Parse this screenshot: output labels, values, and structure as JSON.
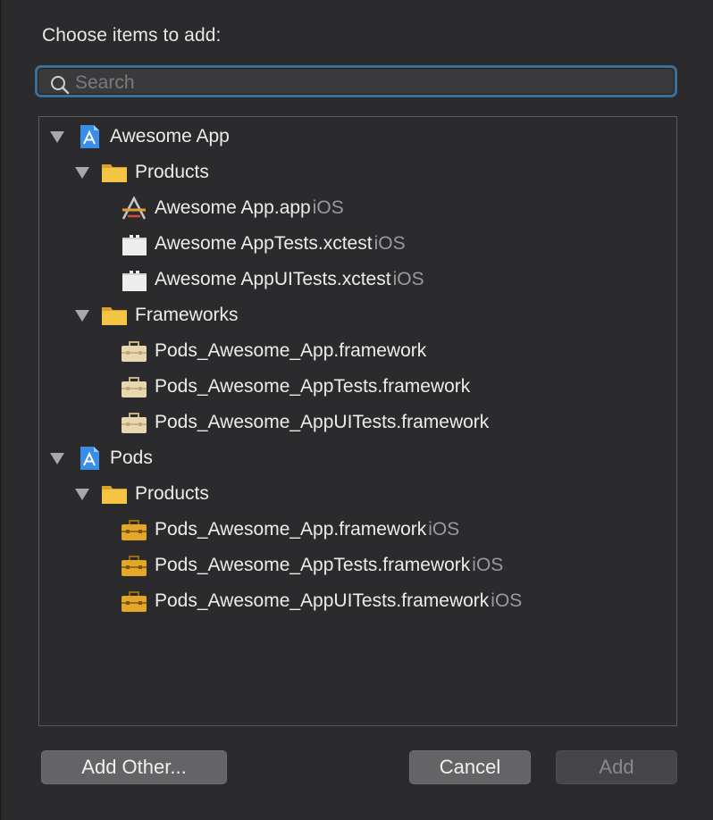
{
  "dialog": {
    "heading": "Choose items to add:"
  },
  "search": {
    "placeholder": "Search",
    "value": ""
  },
  "tree": {
    "awesome_app": {
      "label": "Awesome App",
      "products": {
        "label": "Products",
        "items": [
          {
            "name": "Awesome App.app",
            "platform": "iOS"
          },
          {
            "name": "Awesome AppTests.xctest",
            "platform": "iOS"
          },
          {
            "name": "Awesome AppUITests.xctest",
            "platform": "iOS"
          }
        ]
      },
      "frameworks": {
        "label": "Frameworks",
        "items": [
          {
            "name": "Pods_Awesome_App.framework"
          },
          {
            "name": "Pods_Awesome_AppTests.framework"
          },
          {
            "name": "Pods_Awesome_AppUITests.framework"
          }
        ]
      }
    },
    "pods": {
      "label": "Pods",
      "products": {
        "label": "Products",
        "items": [
          {
            "name": "Pods_Awesome_App.framework",
            "platform": "iOS"
          },
          {
            "name": "Pods_Awesome_AppTests.framework",
            "platform": "iOS"
          },
          {
            "name": "Pods_Awesome_AppUITests.framework",
            "platform": "iOS"
          }
        ]
      }
    }
  },
  "buttons": {
    "add_other": "Add Other...",
    "cancel": "Cancel",
    "add": "Add"
  },
  "colors": {
    "background": "#2b2b2d",
    "focus_ring": "#3d6f9b",
    "folder": "#f5c443",
    "project_icon": "#3b8ee6",
    "toolbox_gold": "#e3a629",
    "toolbox_beige": "#e8d6ae"
  },
  "icons": {
    "search": "magnifier-icon",
    "project": "xcode-project-icon",
    "folder": "folder-icon",
    "app": "app-product-icon",
    "xctest": "bundle-icon",
    "framework": "toolbox-icon"
  }
}
